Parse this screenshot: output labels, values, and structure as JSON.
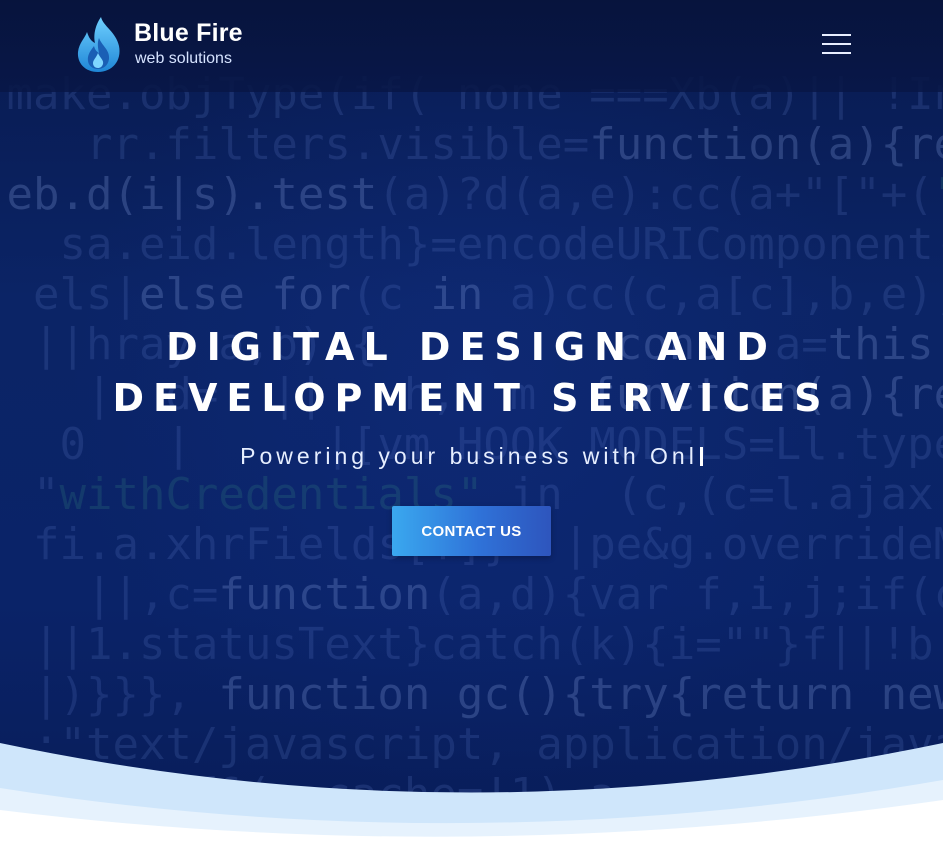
{
  "brand": {
    "name": "Blue Fire",
    "tagline": "web solutions",
    "logo_icon": "flame-icon"
  },
  "nav": {
    "menu_icon": "hamburger-menu-icon"
  },
  "hero": {
    "headline_line1": "DIGITAL DESIGN AND",
    "headline_line2": "DEVELOPMENT SERVICES",
    "subtitle": "Powering your business with Onl",
    "cta_label": "CONTACT US"
  },
  "colors": {
    "hero_background": "#0b2466",
    "button_gradient_start": "#3aa8ef",
    "button_gradient_end": "#2e55bd",
    "wave_light": "#cfe6fb",
    "logo_flame": "#3aa8e8"
  }
}
